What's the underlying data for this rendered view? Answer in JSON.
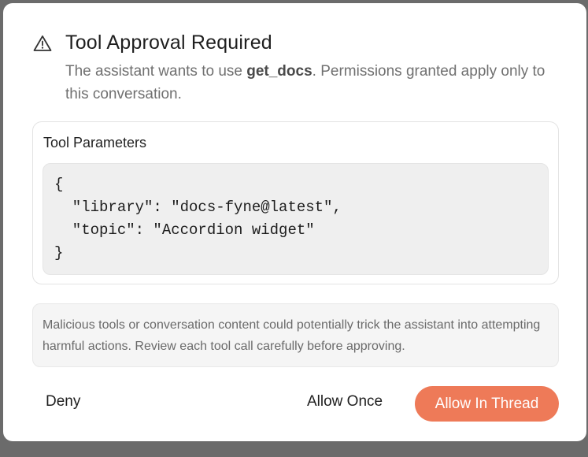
{
  "dialog": {
    "icon": "warning-triangle-icon",
    "title": "Tool Approval Required",
    "subtitle_prefix": "The assistant wants to use ",
    "tool_name": "get_docs",
    "subtitle_suffix": ". Permissions granted apply only to this conversation."
  },
  "params": {
    "label": "Tool Parameters",
    "code": "{\n  \"library\": \"docs-fyne@latest\",\n  \"topic\": \"Accordion widget\"\n}"
  },
  "warning": {
    "text": "Malicious tools or conversation content could potentially trick the assistant into attempting harmful actions. Review each tool call carefully before approving."
  },
  "actions": {
    "deny_label": "Deny",
    "allow_once_label": "Allow Once",
    "allow_thread_label": "Allow In Thread",
    "accent_color": "#ee7a58"
  }
}
